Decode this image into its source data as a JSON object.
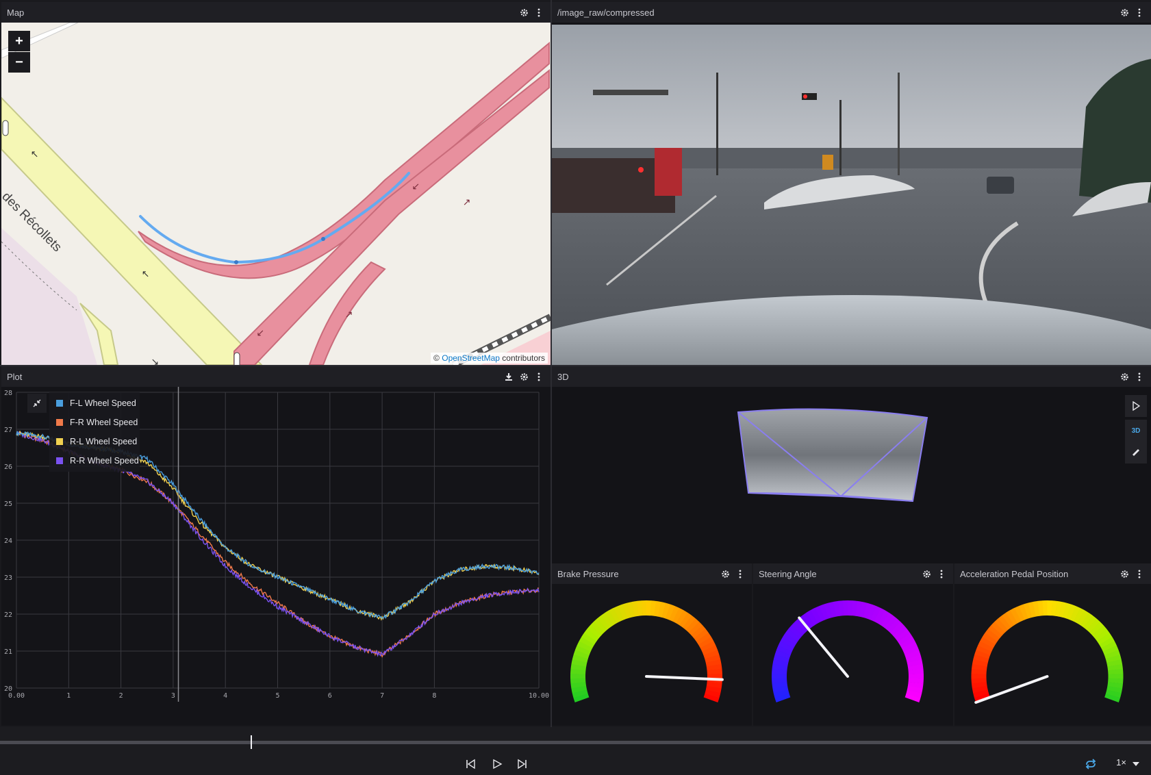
{
  "colors": {
    "fl": "#4a9ede",
    "fr": "#f07a4a",
    "rl": "#f0d050",
    "rr": "#7a52f0",
    "road_major": "#e8909e",
    "road_secondary": "#f5f7b5",
    "land": "#f2efe9",
    "gps_track": "#64aaf0",
    "frustum": "#8a7ef0"
  },
  "map": {
    "title": "Map",
    "zoom_in": "+",
    "zoom_out": "−",
    "street_label": "des Récollets",
    "attribution_prefix": "©",
    "attribution_link": "OpenStreetMap",
    "attribution_suffix": "contributors"
  },
  "camera": {
    "title": "/image_raw/compressed"
  },
  "plot": {
    "title": "Plot",
    "legend": [
      {
        "label": "F-L Wheel Speed",
        "color": "#4a9ede"
      },
      {
        "label": "F-R Wheel Speed",
        "color": "#f07a4a"
      },
      {
        "label": "R-L Wheel Speed",
        "color": "#f0d050"
      },
      {
        "label": "R-R Wheel Speed",
        "color": "#7a52f0"
      }
    ]
  },
  "chart_data": {
    "type": "line",
    "xlim": [
      0,
      10
    ],
    "ylim": [
      20,
      28
    ],
    "x_ticks": [
      "0.00",
      "1",
      "2",
      "3",
      "4",
      "5",
      "6",
      "7",
      "8",
      "10.00"
    ],
    "y_ticks": [
      "20",
      "21",
      "22",
      "23",
      "24",
      "25",
      "26",
      "27",
      "28"
    ],
    "cursor_x": 3.1,
    "grid": true,
    "legend_position": "top-left",
    "series": [
      {
        "name": "F-L Wheel Speed",
        "x": [
          0,
          0.5,
          1,
          1.5,
          2,
          2.5,
          3,
          3.5,
          4,
          4.5,
          5,
          5.5,
          6,
          6.5,
          7,
          7.5,
          8,
          8.5,
          9,
          9.5,
          10
        ],
        "values": [
          26.9,
          26.8,
          26.6,
          26.5,
          26.4,
          26.2,
          25.5,
          24.6,
          23.8,
          23.3,
          23.0,
          22.7,
          22.4,
          22.1,
          21.9,
          22.3,
          22.9,
          23.2,
          23.3,
          23.25,
          23.1
        ]
      },
      {
        "name": "F-R Wheel Speed",
        "x": [
          0,
          0.5,
          1,
          1.5,
          2,
          2.5,
          3,
          3.5,
          4,
          4.5,
          5,
          5.5,
          6,
          6.5,
          7,
          7.5,
          8,
          8.5,
          9,
          9.5,
          10
        ],
        "values": [
          26.9,
          26.7,
          26.4,
          26.1,
          25.9,
          25.6,
          25.0,
          24.2,
          23.4,
          22.8,
          22.3,
          21.8,
          21.4,
          21.1,
          20.9,
          21.4,
          22.0,
          22.3,
          22.5,
          22.6,
          22.65
        ]
      },
      {
        "name": "R-L Wheel Speed",
        "x": [
          0,
          0.5,
          1,
          1.5,
          2,
          2.5,
          3,
          3.5,
          4,
          4.5,
          5,
          5.5,
          6,
          6.5,
          7,
          7.5,
          8,
          8.5,
          9,
          9.5,
          10
        ],
        "values": [
          26.9,
          26.8,
          26.6,
          26.5,
          26.4,
          26.1,
          25.4,
          24.5,
          23.8,
          23.3,
          23.0,
          22.7,
          22.4,
          22.1,
          21.9,
          22.3,
          22.9,
          23.2,
          23.3,
          23.25,
          23.1
        ]
      },
      {
        "name": "R-R Wheel Speed",
        "x": [
          0,
          0.5,
          1,
          1.5,
          2,
          2.5,
          3,
          3.5,
          4,
          4.5,
          5,
          5.5,
          6,
          6.5,
          7,
          7.5,
          8,
          8.5,
          9,
          9.5,
          10
        ],
        "values": [
          26.9,
          26.7,
          26.4,
          26.1,
          25.9,
          25.6,
          25.0,
          24.1,
          23.3,
          22.7,
          22.2,
          21.8,
          21.4,
          21.1,
          20.9,
          21.4,
          22.0,
          22.3,
          22.5,
          22.6,
          22.65
        ]
      }
    ]
  },
  "scene3d": {
    "title": "3D",
    "mode_label": "3D"
  },
  "gauges": [
    {
      "title": "Brake Pressure",
      "value": 0.92,
      "colors": [
        "#22cc22",
        "#aaee00",
        "#ffcc00",
        "#ff6600",
        "#ff0000"
      ]
    },
    {
      "title": "Steering Angle",
      "value": 0.32,
      "colors": [
        "#2222ff",
        "#7700ff",
        "#bb00ff",
        "#ff00ff"
      ]
    },
    {
      "title": "Acceleration Pedal Position",
      "value": 0.0,
      "colors": [
        "#ff0000",
        "#ff6600",
        "#ffdd00",
        "#aaee00",
        "#22cc22"
      ]
    }
  ],
  "playback": {
    "progress": 0.218,
    "speed_label": "1×"
  }
}
